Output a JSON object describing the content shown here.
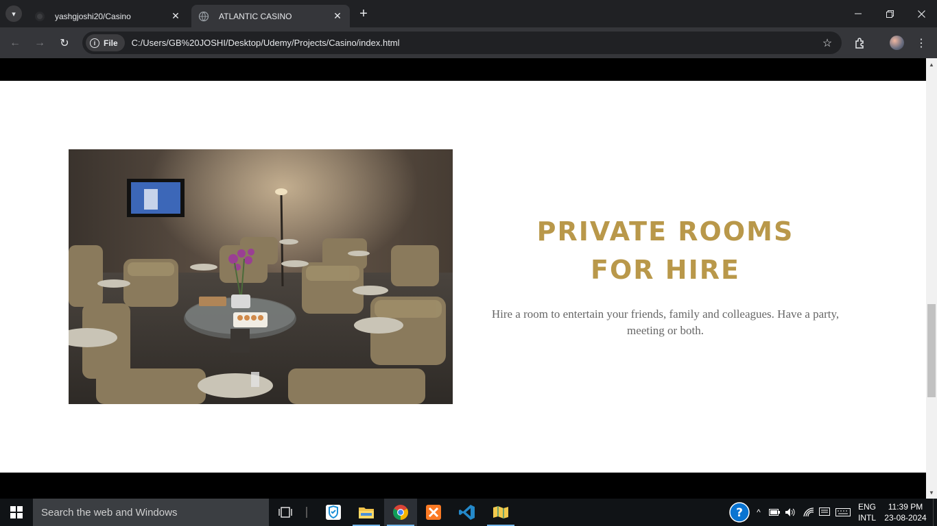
{
  "browser": {
    "tabs": [
      {
        "title": "yashgjoshi20/Casino",
        "favicon": "github-icon",
        "active": false
      },
      {
        "title": "ATLANTIC CASINO",
        "favicon": "globe-icon",
        "active": true
      }
    ],
    "chip_label": "File",
    "url": "C:/Users/GB%20JOSHI/Desktop/Udemy/Projects/Casino/index.html"
  },
  "page": {
    "rooms_title_line1": "PRIVATE ROOMS",
    "rooms_title_line2": "FOR HIRE",
    "rooms_description": "Hire a room to entertain your friends, family and colleagues. Have a party, meeting or both.",
    "accent_color": "#b9984a",
    "image_alt": "Lounge with beige armchairs, round glass table with orchids and snacks, wall-mounted TV"
  },
  "taskbar": {
    "search_placeholder": "Search the web and Windows",
    "language_line1": "ENG",
    "language_line2": "INTL",
    "time": "11:39 PM",
    "date": "23-08-2024"
  }
}
